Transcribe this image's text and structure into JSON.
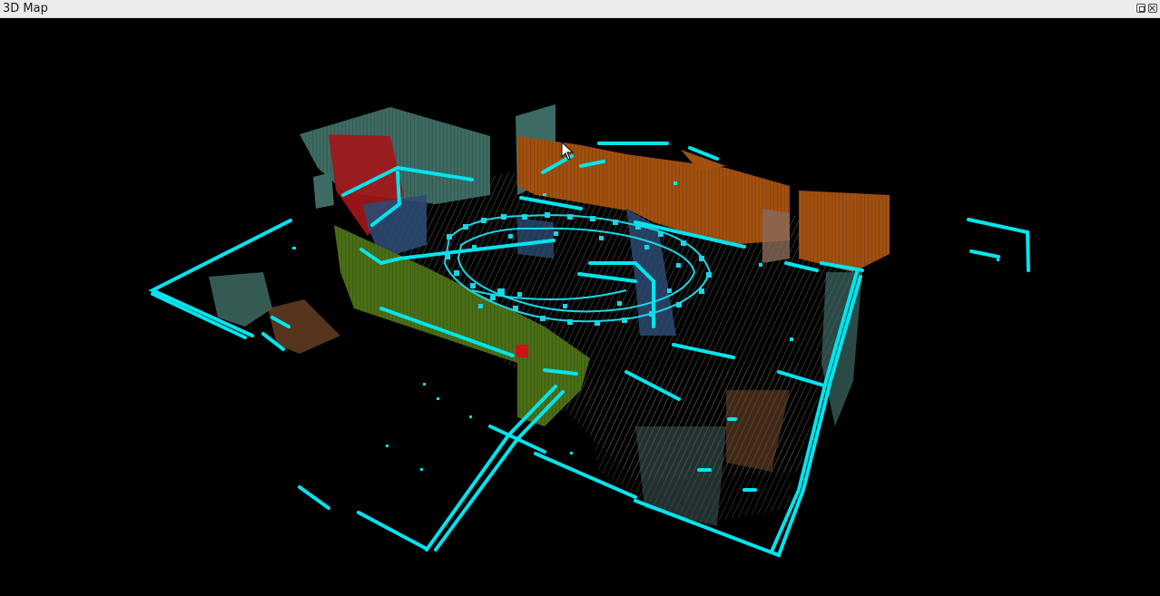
{
  "window": {
    "title": "3D Map",
    "buttons": [
      "float-button",
      "close-button"
    ]
  },
  "viewport": {
    "background": "#000000",
    "colors": {
      "occupancy_edges": "#00e5ee",
      "graph_nodes": "#19d7e6",
      "floor_points": "#5a5a5a",
      "wall_orange": "#a0500f",
      "wall_green": "#4a6e16",
      "wall_teal": "#3d6a62",
      "wall_blue": "#2c4a72",
      "wall_red": "#a4161a",
      "marker_red": "#c8141a"
    },
    "cursor": "arrow-cursor-icon"
  }
}
